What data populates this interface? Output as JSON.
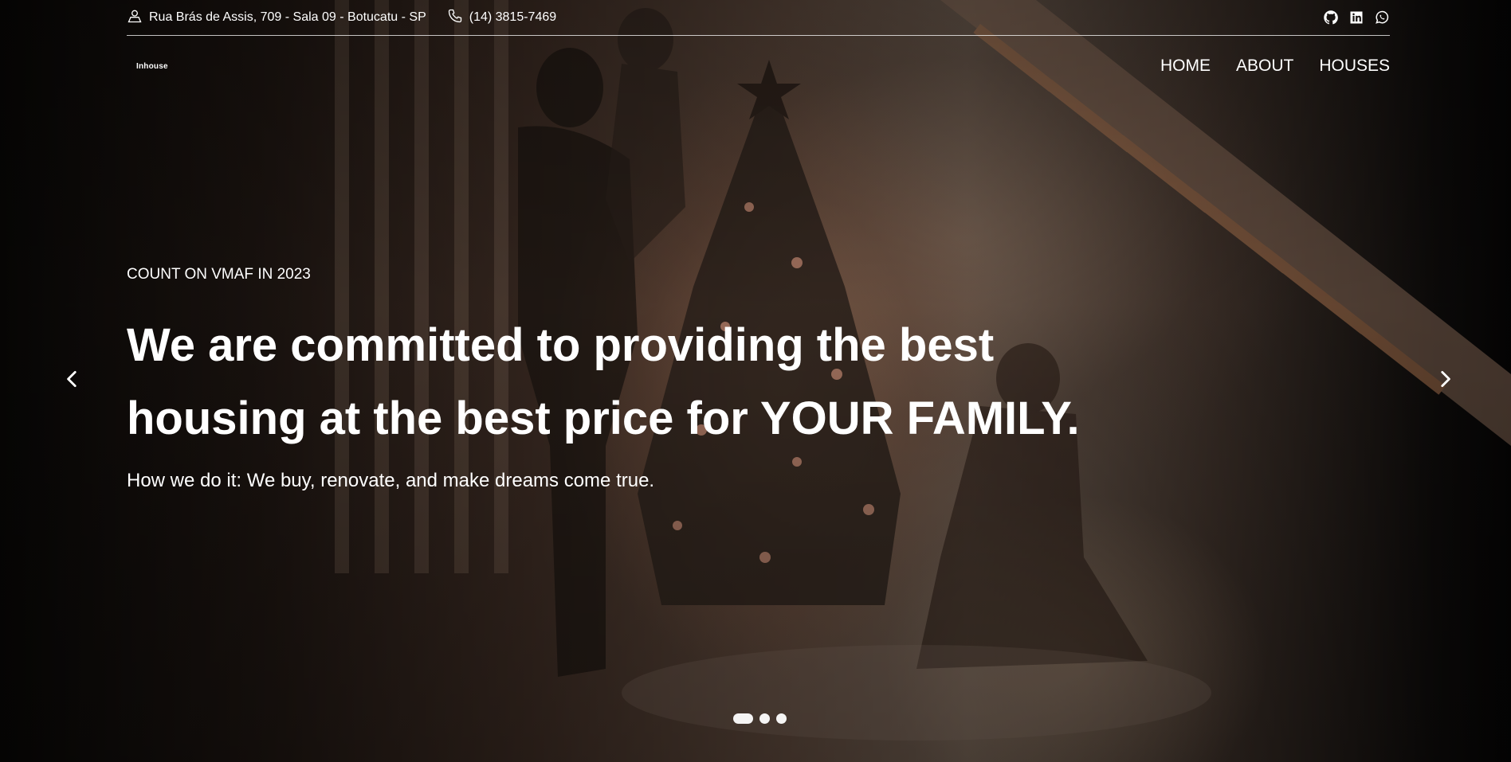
{
  "topbar": {
    "address": "Rua Brás de Assis, 709 - Sala 09 - Botucatu - SP",
    "phone": "(14) 3815-7469",
    "social_icons": [
      "github-icon",
      "linkedin-icon",
      "whatsapp-icon"
    ]
  },
  "nav": {
    "logo": "Inhouse",
    "items": [
      {
        "label": "HOME"
      },
      {
        "label": "ABOUT"
      },
      {
        "label": "HOUSES"
      }
    ]
  },
  "hero": {
    "eyebrow": "COUNT ON VMAF IN 2023",
    "headline_line1": "We are committed to providing the best",
    "headline_line2": "housing at the best price for YOUR FAMILY.",
    "subline": "How we do it: We buy, renovate, and make dreams come true."
  },
  "carousel": {
    "slide_count": 3,
    "active_index": 0,
    "prev_icon": "chevron-left-icon",
    "next_icon": "chevron-right-icon"
  },
  "colors": {
    "text": "#ffffff",
    "background": "#0b0908"
  }
}
